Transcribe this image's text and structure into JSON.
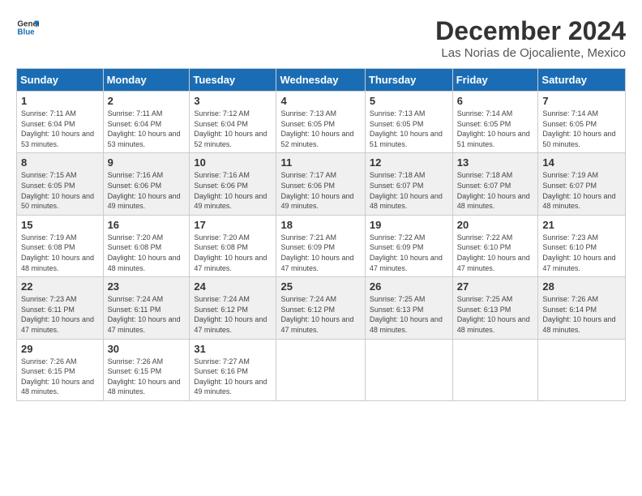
{
  "header": {
    "logo_general": "General",
    "logo_blue": "Blue",
    "title": "December 2024",
    "subtitle": "Las Norias de Ojocaliente, Mexico"
  },
  "calendar": {
    "days_of_week": [
      "Sunday",
      "Monday",
      "Tuesday",
      "Wednesday",
      "Thursday",
      "Friday",
      "Saturday"
    ],
    "weeks": [
      [
        null,
        {
          "day": "2",
          "sunrise": "7:11 AM",
          "sunset": "6:04 PM",
          "daylight": "10 hours and 53 minutes."
        },
        {
          "day": "3",
          "sunrise": "7:12 AM",
          "sunset": "6:04 PM",
          "daylight": "10 hours and 52 minutes."
        },
        {
          "day": "4",
          "sunrise": "7:13 AM",
          "sunset": "6:05 PM",
          "daylight": "10 hours and 52 minutes."
        },
        {
          "day": "5",
          "sunrise": "7:13 AM",
          "sunset": "6:05 PM",
          "daylight": "10 hours and 51 minutes."
        },
        {
          "day": "6",
          "sunrise": "7:14 AM",
          "sunset": "6:05 PM",
          "daylight": "10 hours and 51 minutes."
        },
        {
          "day": "7",
          "sunrise": "7:14 AM",
          "sunset": "6:05 PM",
          "daylight": "10 hours and 50 minutes."
        }
      ],
      [
        {
          "day": "1",
          "sunrise": "7:11 AM",
          "sunset": "6:04 PM",
          "daylight": "10 hours and 53 minutes."
        },
        {
          "day": "9",
          "sunrise": "7:16 AM",
          "sunset": "6:06 PM",
          "daylight": "10 hours and 49 minutes."
        },
        {
          "day": "10",
          "sunrise": "7:16 AM",
          "sunset": "6:06 PM",
          "daylight": "10 hours and 49 minutes."
        },
        {
          "day": "11",
          "sunrise": "7:17 AM",
          "sunset": "6:06 PM",
          "daylight": "10 hours and 49 minutes."
        },
        {
          "day": "12",
          "sunrise": "7:18 AM",
          "sunset": "6:07 PM",
          "daylight": "10 hours and 48 minutes."
        },
        {
          "day": "13",
          "sunrise": "7:18 AM",
          "sunset": "6:07 PM",
          "daylight": "10 hours and 48 minutes."
        },
        {
          "day": "14",
          "sunrise": "7:19 AM",
          "sunset": "6:07 PM",
          "daylight": "10 hours and 48 minutes."
        }
      ],
      [
        {
          "day": "8",
          "sunrise": "7:15 AM",
          "sunset": "6:05 PM",
          "daylight": "10 hours and 50 minutes."
        },
        {
          "day": "16",
          "sunrise": "7:20 AM",
          "sunset": "6:08 PM",
          "daylight": "10 hours and 48 minutes."
        },
        {
          "day": "17",
          "sunrise": "7:20 AM",
          "sunset": "6:08 PM",
          "daylight": "10 hours and 47 minutes."
        },
        {
          "day": "18",
          "sunrise": "7:21 AM",
          "sunset": "6:09 PM",
          "daylight": "10 hours and 47 minutes."
        },
        {
          "day": "19",
          "sunrise": "7:22 AM",
          "sunset": "6:09 PM",
          "daylight": "10 hours and 47 minutes."
        },
        {
          "day": "20",
          "sunrise": "7:22 AM",
          "sunset": "6:10 PM",
          "daylight": "10 hours and 47 minutes."
        },
        {
          "day": "21",
          "sunrise": "7:23 AM",
          "sunset": "6:10 PM",
          "daylight": "10 hours and 47 minutes."
        }
      ],
      [
        {
          "day": "15",
          "sunrise": "7:19 AM",
          "sunset": "6:08 PM",
          "daylight": "10 hours and 48 minutes."
        },
        {
          "day": "23",
          "sunrise": "7:24 AM",
          "sunset": "6:11 PM",
          "daylight": "10 hours and 47 minutes."
        },
        {
          "day": "24",
          "sunrise": "7:24 AM",
          "sunset": "6:12 PM",
          "daylight": "10 hours and 47 minutes."
        },
        {
          "day": "25",
          "sunrise": "7:24 AM",
          "sunset": "6:12 PM",
          "daylight": "10 hours and 47 minutes."
        },
        {
          "day": "26",
          "sunrise": "7:25 AM",
          "sunset": "6:13 PM",
          "daylight": "10 hours and 48 minutes."
        },
        {
          "day": "27",
          "sunrise": "7:25 AM",
          "sunset": "6:13 PM",
          "daylight": "10 hours and 48 minutes."
        },
        {
          "day": "28",
          "sunrise": "7:26 AM",
          "sunset": "6:14 PM",
          "daylight": "10 hours and 48 minutes."
        }
      ],
      [
        {
          "day": "22",
          "sunrise": "7:23 AM",
          "sunset": "6:11 PM",
          "daylight": "10 hours and 47 minutes."
        },
        {
          "day": "30",
          "sunrise": "7:26 AM",
          "sunset": "6:15 PM",
          "daylight": "10 hours and 48 minutes."
        },
        {
          "day": "31",
          "sunrise": "7:27 AM",
          "sunset": "6:16 PM",
          "daylight": "10 hours and 49 minutes."
        },
        null,
        null,
        null,
        null
      ],
      [
        {
          "day": "29",
          "sunrise": "7:26 AM",
          "sunset": "6:15 PM",
          "daylight": "10 hours and 48 minutes."
        },
        null,
        null,
        null,
        null,
        null,
        null
      ]
    ]
  }
}
